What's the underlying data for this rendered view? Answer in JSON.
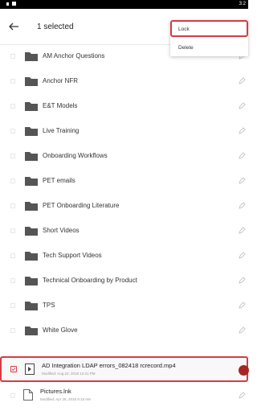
{
  "status_bar": {
    "time": "3:2"
  },
  "toolbar": {
    "title": "1 selected"
  },
  "menu": {
    "items": [
      {
        "label": "Lock"
      },
      {
        "label": "Delete"
      }
    ]
  },
  "folders": [
    {
      "label": "AM Anchor Questions"
    },
    {
      "label": "Anchor NFR"
    },
    {
      "label": "E&T Models"
    },
    {
      "label": "Live Training"
    },
    {
      "label": "Onboarding Workflows"
    },
    {
      "label": "PET emails"
    },
    {
      "label": "PET Onboarding Literature"
    },
    {
      "label": "Short Videos"
    },
    {
      "label": "Tech Support Videos"
    },
    {
      "label": "Technical Onboarding by Product"
    },
    {
      "label": "TPS"
    },
    {
      "label": "White Glove"
    }
  ],
  "files": [
    {
      "name": "AD Integration LDAP errors_082418 rcrecord.mp4",
      "meta": "Modified: Aug 24, 2018 12:21 PM",
      "selected": true
    },
    {
      "name": "Pictures.lnk",
      "meta": "Modified: Apr 28, 2016 9:18 AM",
      "selected": false
    }
  ],
  "colors": {
    "accent": "#d83a43",
    "folder": "#555555",
    "red_dot": "#a42623"
  }
}
